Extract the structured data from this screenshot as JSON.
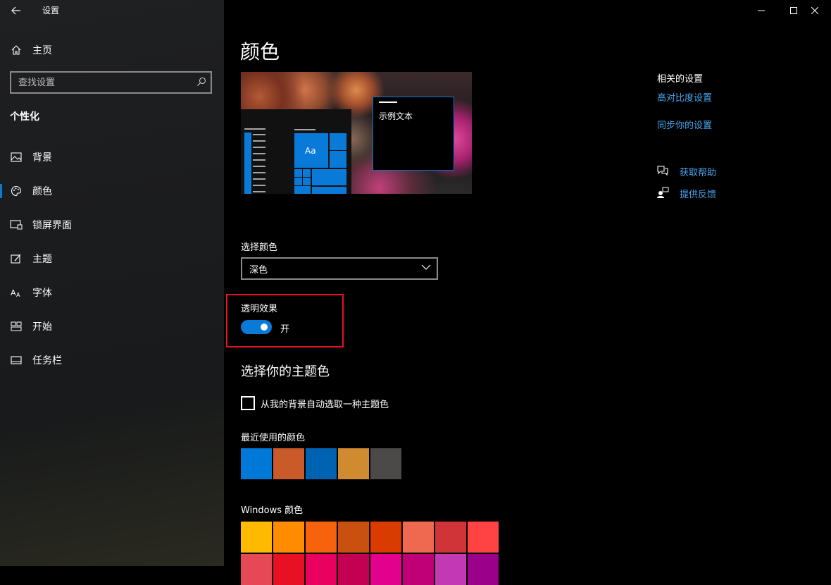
{
  "window": {
    "title": "设置",
    "controls": [
      "minimize-icon",
      "maximize-icon",
      "close-icon"
    ]
  },
  "sidebar": {
    "home_label": "主页",
    "search_placeholder": "查找设置",
    "section_title": "个性化",
    "items": [
      {
        "label": "背景",
        "icon": "picture-icon"
      },
      {
        "label": "颜色",
        "icon": "palette-icon",
        "active": true
      },
      {
        "label": "锁屏界面",
        "icon": "lock-screen-icon"
      },
      {
        "label": "主题",
        "icon": "theme-brush-icon"
      },
      {
        "label": "字体",
        "icon": "font-icon"
      },
      {
        "label": "开始",
        "icon": "start-tiles-icon"
      },
      {
        "label": "任务栏",
        "icon": "taskbar-icon"
      }
    ]
  },
  "main": {
    "title": "颜色",
    "preview_sample_text": "示例文本",
    "preview_tile_text": "Aa",
    "choose_color_label": "选择颜色",
    "choose_color_value": "深色",
    "transparency_label": "透明效果",
    "transparency_state": "开",
    "accent_heading": "选择你的主题色",
    "auto_accent_label": "从我的背景自动选取一种主题色",
    "auto_accent_checked": false,
    "recent_colors_label": "最近使用的颜色",
    "recent_colors": [
      "#0078d7",
      "#ca5a2a",
      "#0063b1",
      "#d08a30",
      "#4c4a48"
    ],
    "windows_colors_label": "Windows 颜色",
    "windows_colors_row1": [
      "#ffb900",
      "#ff8c00",
      "#f7630c",
      "#ca5010",
      "#da3b01",
      "#ef6950",
      "#d13438",
      "#ff4343"
    ],
    "windows_colors_row2": [
      "#e74856",
      "#e81123",
      "#ea005e",
      "#c30052",
      "#e3008c",
      "#bf0077",
      "#c239b3",
      "#9a0089"
    ]
  },
  "related": {
    "heading": "相关的设置",
    "links": [
      "高对比度设置",
      "同步你的设置"
    ],
    "help": [
      {
        "label": "获取帮助",
        "icon": "help-chat-icon"
      },
      {
        "label": "提供反馈",
        "icon": "feedback-icon"
      }
    ]
  },
  "colors": {
    "accent": "#0a7ad8",
    "link": "#4aa3f0",
    "highlight": "#e81123"
  }
}
